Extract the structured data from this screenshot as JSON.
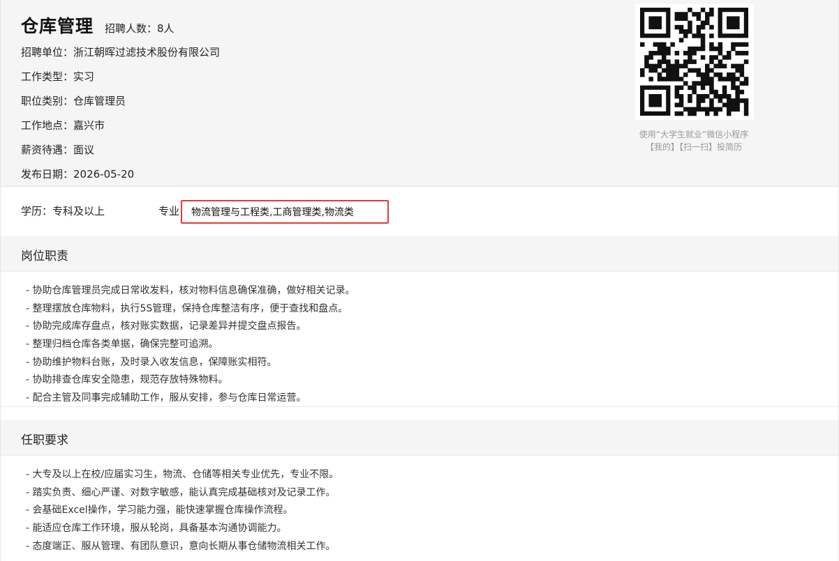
{
  "job": {
    "title": "仓库管理",
    "hire_count": "招聘人数：8人",
    "info": [
      "招聘单位：浙江朝晖过滤技术股份有限公司",
      "工作类型：实习",
      "职位类别：仓库管理员",
      "工作地点：嘉兴市",
      "薪资待遇：面议",
      "发布日期：2026-05-20"
    ]
  },
  "qr": {
    "icon": "qr-code-icon",
    "caption_line1": "使用“大学生就业”微信小程序",
    "caption_line2": "【我的】【扫一扫】投简历"
  },
  "requirements_summary": {
    "education": "学历：专科及以上",
    "major_label": "专业：",
    "major_value": "物流管理与工程类,工商管理类,物流类",
    "highlight_color": "#e03a3a"
  },
  "duties": {
    "title": "岗位职责",
    "items": [
      "- 协助仓库管理员完成日常收发料，核对物料信息确保准确，做好相关记录。",
      "- 整理摆放仓库物料，执行5S管理，保持仓库整洁有序，便于查找和盘点。",
      "- 协助完成库存盘点，核对账实数据，记录差异并提交盘点报告。",
      "- 整理归档仓库各类单据，确保完整可追溯。",
      "- 协助维护物料台账，及时录入收发信息，保障账实相符。",
      "- 协助排查仓库安全隐患，规范存放特殊物料。",
      "- 配合主管及同事完成辅助工作，服从安排，参与仓库日常运营。"
    ]
  },
  "qualifications": {
    "title": "任职要求",
    "items": [
      "- 大专及以上在校/应届实习生，物流、仓储等相关专业优先，专业不限。",
      "- 踏实负责、细心严谨、对数字敏感，能认真完成基础核对及记录工作。",
      "- 会基础Excel操作，学习能力强，能快速掌握仓库操作流程。",
      "- 能适应仓库工作环境，服从轮岗，具备基本沟通协调能力。",
      "- 态度端正、服从管理、有团队意识，意向长期从事仓储物流相关工作。"
    ]
  }
}
